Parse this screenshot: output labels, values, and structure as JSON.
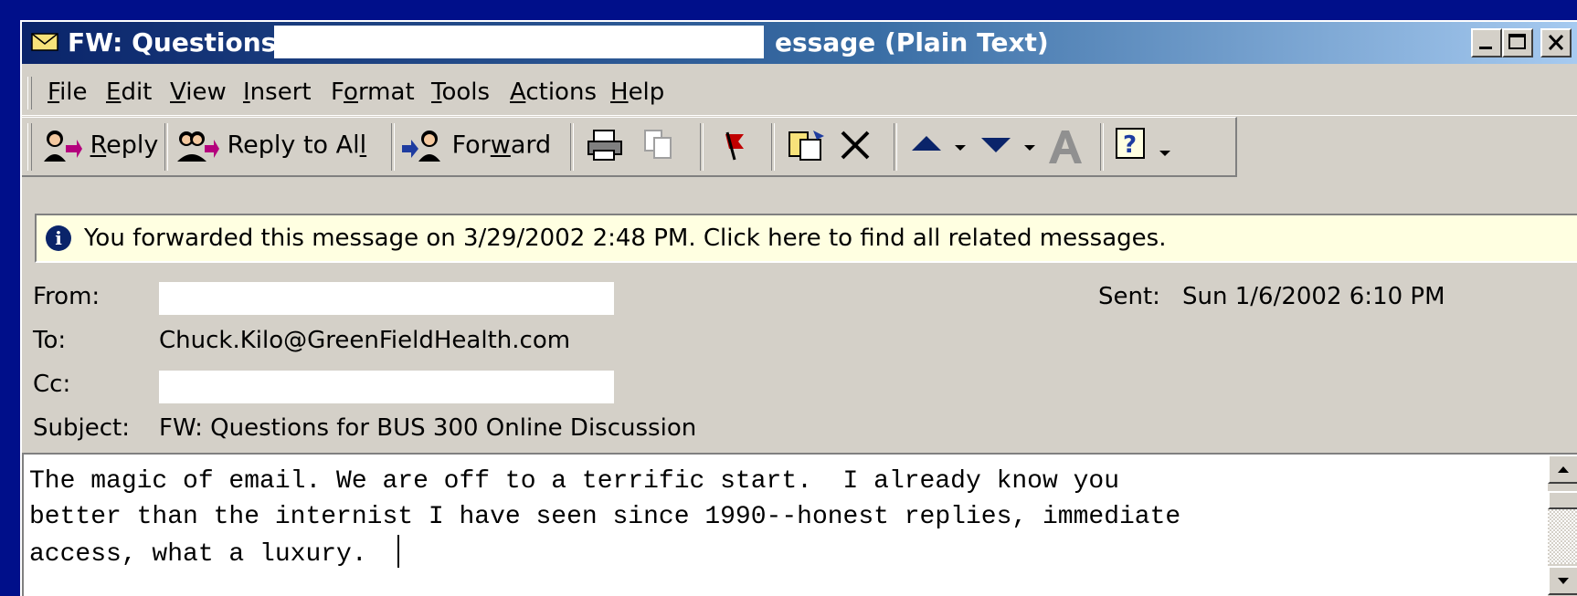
{
  "window": {
    "title_left": "FW: Questions",
    "title_right": "essage (Plain Text)",
    "controls": [
      "minimize",
      "maximize",
      "close"
    ]
  },
  "menu": {
    "items": [
      {
        "label": "File",
        "underline": "F"
      },
      {
        "label": "Edit",
        "underline": "E"
      },
      {
        "label": "View",
        "underline": "V"
      },
      {
        "label": "Insert",
        "underline": "I"
      },
      {
        "label": "Format",
        "underline": "o"
      },
      {
        "label": "Tools",
        "underline": "T"
      },
      {
        "label": "Actions",
        "underline": "A"
      },
      {
        "label": "Help",
        "underline": "H"
      }
    ]
  },
  "toolbar": {
    "reply": "Reply",
    "reply_all": "Reply to All",
    "forward": "Forward",
    "icons": [
      "print-icon",
      "copy-icon",
      "flag-icon",
      "move-to-folder-icon",
      "delete-icon",
      "previous-item-icon",
      "next-item-icon",
      "address-book-icon",
      "help-icon"
    ]
  },
  "infobar": {
    "text": "You forwarded this message on 3/29/2002 2:48 PM. Click here to find all related messages."
  },
  "headers": {
    "from_label": "From:",
    "to_label": "To:",
    "to_value": "Chuck.Kilo@GreenFieldHealth.com",
    "cc_label": "Cc:",
    "subject_label": "Subject:",
    "subject_value": "FW: Questions for BUS 300 Online Discussion",
    "sent_label": "Sent:",
    "sent_value": "Sun 1/6/2002 6:10 PM"
  },
  "body": {
    "line1": "The magic of email. We are off to a terrific start.  I already know you",
    "line2": "better than the internist I have seen since 1990--honest replies, immediate",
    "line3": "access, what a luxury.  "
  },
  "colors": {
    "desktop": "#000f8a",
    "titlebar_start": "#0a246a",
    "titlebar_end": "#a6caf0",
    "chrome": "#d4d0c8",
    "infobar": "#ffffe1"
  }
}
